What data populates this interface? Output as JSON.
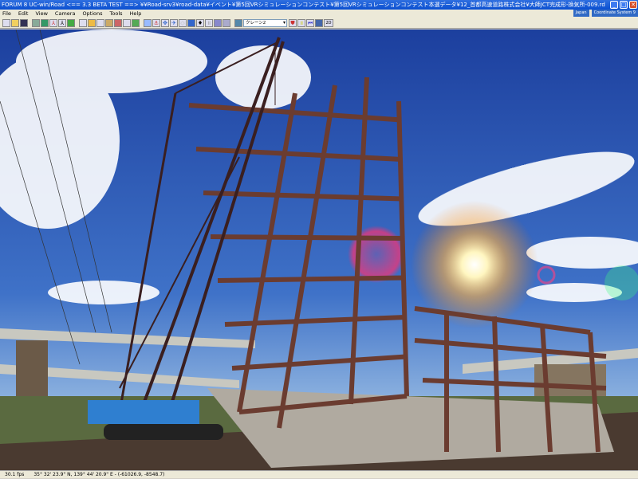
{
  "window": {
    "title": "FORUM 8    UC-win/Road    <== 3.3 BETA TEST ==>     ¥¥Road-srv3¥road-data¥イベント¥第5回VRシミュレーションコンテスト¥第5回VRシミュレーションコンテスト本選データ¥12_首都高速道路株式会社¥大師JCT完成形-換気所-009.rd",
    "minimize": "_",
    "maximize": "□",
    "close": "✕"
  },
  "menu": [
    "File",
    "Edit",
    "View",
    "Camera",
    "Options",
    "Tools",
    "Help"
  ],
  "menu_right": {
    "region": "Japan",
    "coords": "Coordinate System 9"
  },
  "toolbar": {
    "model_select": "クレーン2",
    "view_2d": "2D"
  },
  "status": {
    "fps": "30.1 fps",
    "position": "35° 32' 23.9\" N, 139° 44' 20.9\" E  -  (-61026.9, -8548.7)"
  },
  "colors": {
    "sky_top": "#1c3f9e",
    "sky_horizon": "#8fb4e0",
    "steel": "#6b3c30",
    "crane_boom": "#3a1f20",
    "crane_body": "#2f7fd0",
    "ground": "#4a3a30"
  }
}
